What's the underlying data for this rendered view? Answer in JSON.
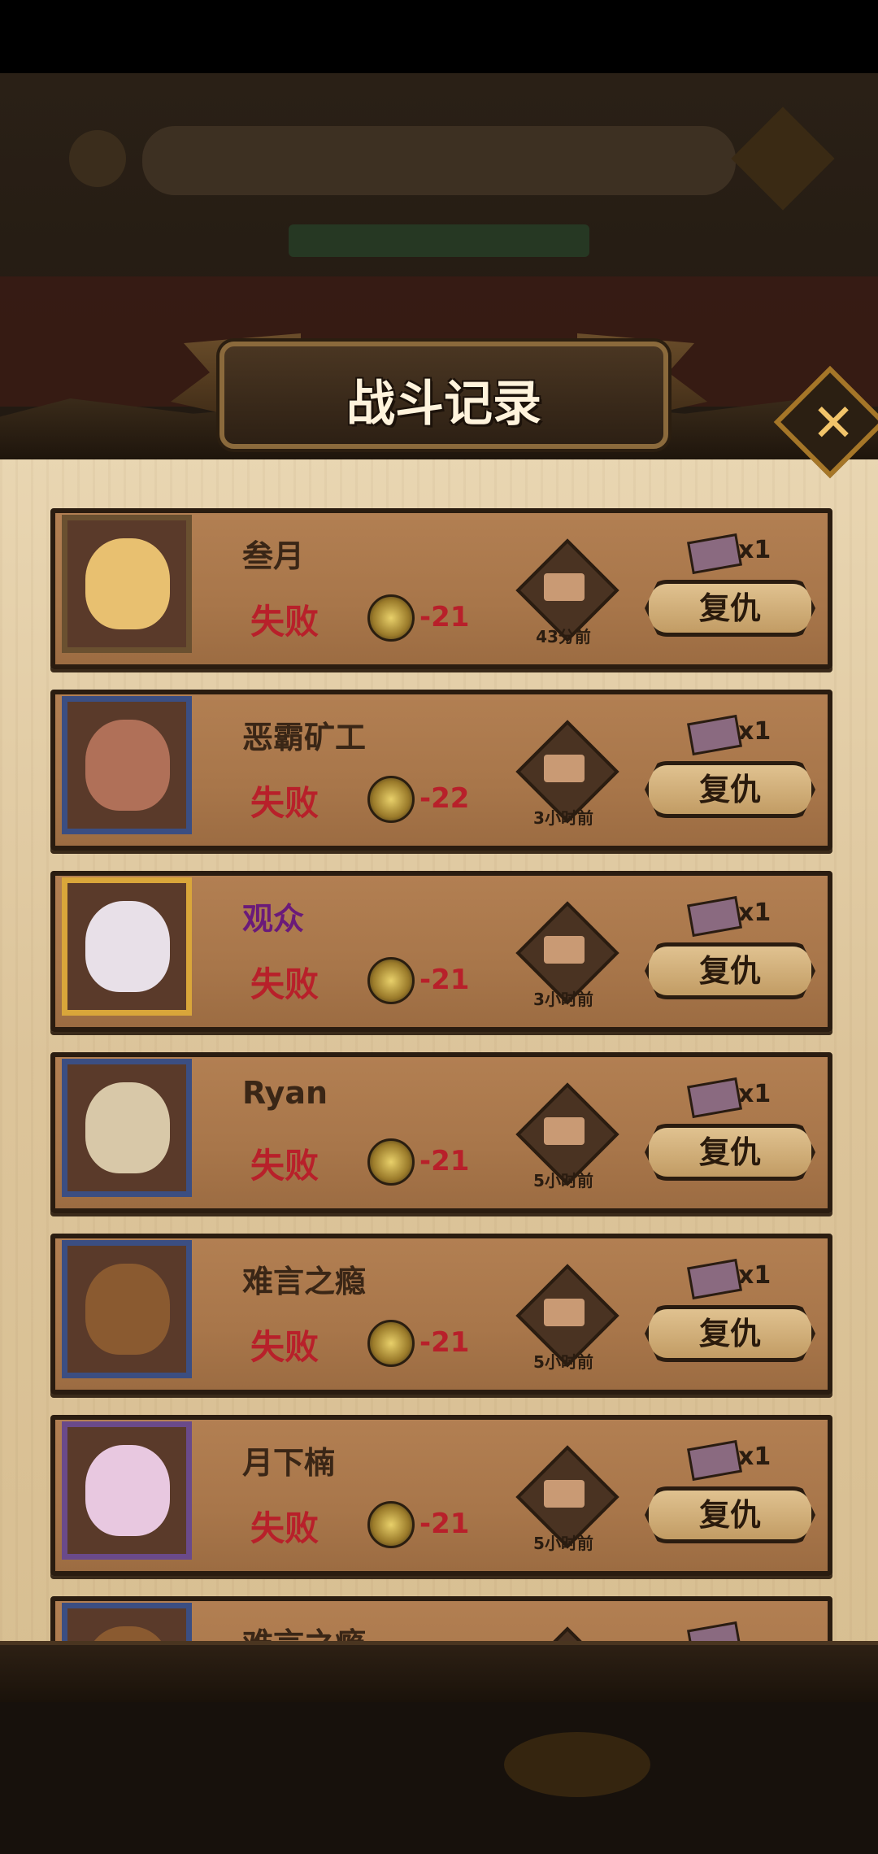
{
  "dialog": {
    "title": "战斗记录",
    "close_label": "✕"
  },
  "records": [
    {
      "name": "叁月",
      "result": "失败",
      "score": "-21",
      "time": "43分前",
      "tickets": "x1",
      "revenge": "复仇",
      "frame": "plain",
      "face": "#e8c070"
    },
    {
      "name": "恶霸矿工",
      "result": "失败",
      "score": "-22",
      "time": "3小时前",
      "tickets": "x1",
      "revenge": "复仇",
      "frame": "blue",
      "face": "#b07058"
    },
    {
      "name": "观众",
      "result": "失败",
      "score": "-21",
      "time": "3小时前",
      "tickets": "x1",
      "revenge": "复仇",
      "frame": "gold",
      "face": "#e8e0e8"
    },
    {
      "name": "Ryan",
      "result": "失败",
      "score": "-21",
      "time": "5小时前",
      "tickets": "x1",
      "revenge": "复仇",
      "frame": "blue",
      "face": "#d8c8a8"
    },
    {
      "name": "难言之瘾",
      "result": "失败",
      "score": "-21",
      "time": "5小时前",
      "tickets": "x1",
      "revenge": "复仇",
      "frame": "blue",
      "face": "#8a5a30"
    },
    {
      "name": "月下楠",
      "result": "失败",
      "score": "-21",
      "time": "5小时前",
      "tickets": "x1",
      "revenge": "复仇",
      "frame": "purple",
      "face": "#e8c8e0"
    },
    {
      "name": "难言之瘾",
      "result": "",
      "score": "",
      "time": "",
      "tickets": "",
      "revenge": "",
      "frame": "blue",
      "face": "#8a5a30"
    }
  ]
}
